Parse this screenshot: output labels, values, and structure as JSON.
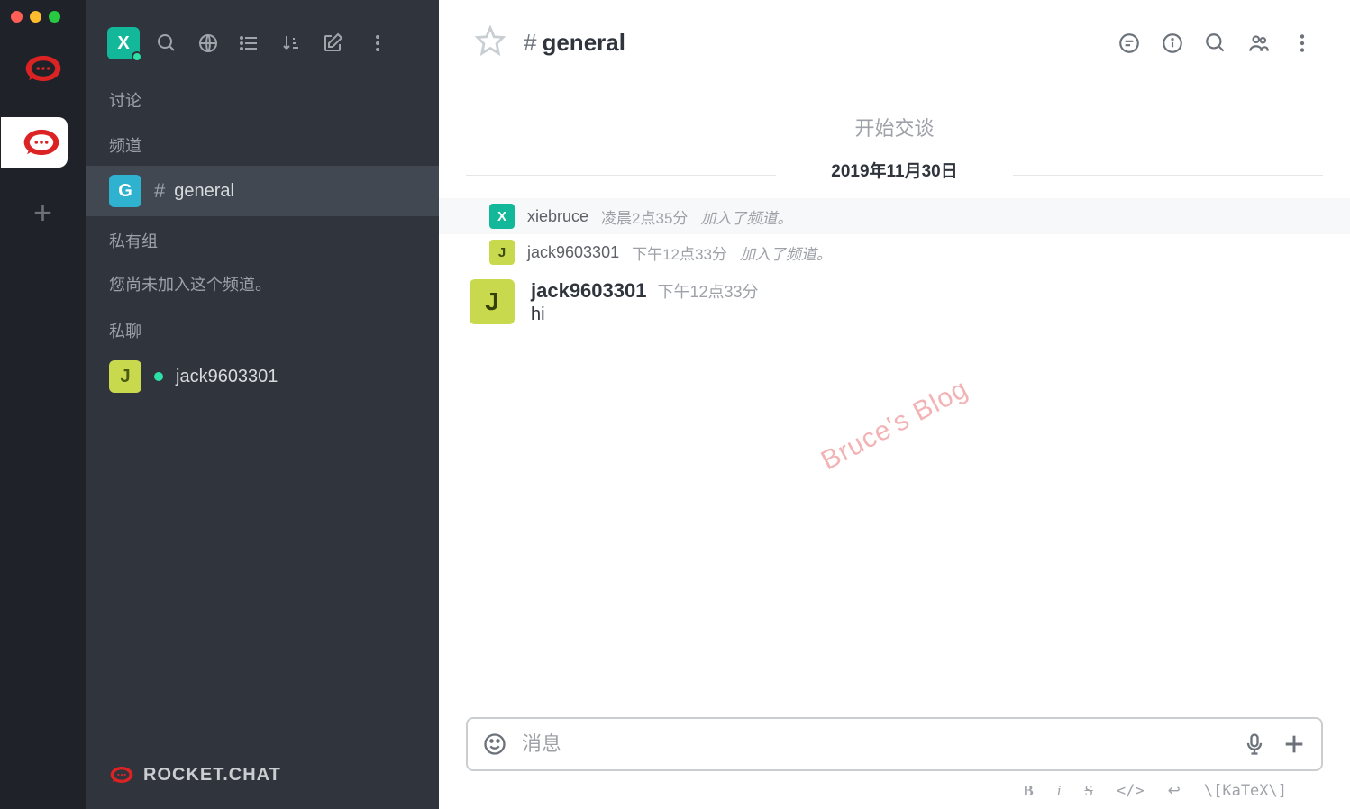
{
  "sidebar": {
    "sections": {
      "discussions": "讨论",
      "channels": "频道",
      "private": "私有组",
      "private_empty": "您尚未加入这个频道。",
      "direct": "私聊"
    },
    "channel_general": "general",
    "dm_user": "jack9603301",
    "footer_brand": "ROCKET.CHAT",
    "self_avatar_letter": "X",
    "avatar_g": "G",
    "avatar_j": "J"
  },
  "header": {
    "channel_name": "general"
  },
  "messages": {
    "start": "开始交谈",
    "date": "2019年11月30日",
    "sys1": {
      "avatar": "X",
      "user": "xiebruce",
      "time": "凌晨2点35分",
      "action": "加入了频道。"
    },
    "sys2": {
      "avatar": "J",
      "user": "jack9603301",
      "time": "下午12点33分",
      "action": "加入了频道。"
    },
    "msg1": {
      "avatar": "J",
      "user": "jack9603301",
      "time": "下午12点33分",
      "text": "hi"
    }
  },
  "composer": {
    "placeholder": "消息"
  },
  "format": {
    "bold": "B",
    "italic": "i",
    "strike": "S",
    "code": "</>",
    "newline": "↩",
    "katex": "\\[KaTeX\\]"
  },
  "watermark": "Bruce's Blog"
}
